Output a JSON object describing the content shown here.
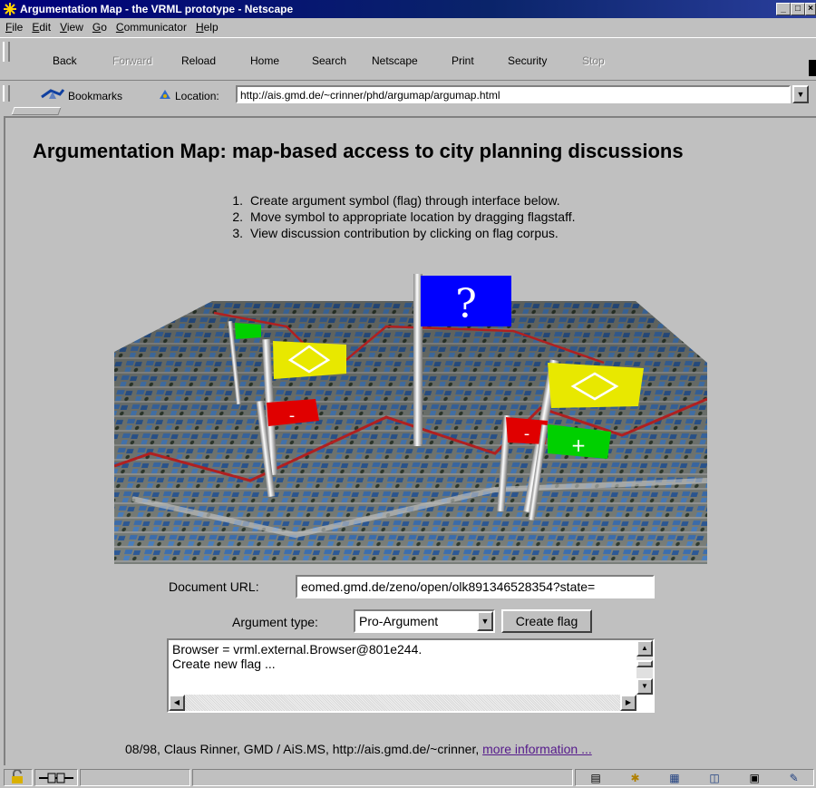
{
  "window": {
    "title": "Argumentation Map - the VRML prototype - Netscape",
    "controls": {
      "minimize": "_",
      "maximize": "□",
      "close": "×"
    }
  },
  "menu": [
    {
      "label": "File",
      "accel": "F"
    },
    {
      "label": "Edit",
      "accel": "E"
    },
    {
      "label": "View",
      "accel": "V"
    },
    {
      "label": "Go",
      "accel": "G"
    },
    {
      "label": "Communicator",
      "accel": "C"
    },
    {
      "label": "Help",
      "accel": "H"
    }
  ],
  "toolbar": {
    "back": "Back",
    "forward": "Forward",
    "reload": "Reload",
    "home": "Home",
    "search": "Search",
    "netscape": "Netscape",
    "print": "Print",
    "security": "Security",
    "stop": "Stop"
  },
  "location_bar": {
    "bookmarks_label": "Bookmarks",
    "location_label": "Location:",
    "url": "http://ais.gmd.de/~crinner/phd/argumap/argumap.html"
  },
  "page": {
    "title": "Argumentation Map: map-based access to city planning discussions",
    "steps": [
      "Create argument symbol (flag) through interface below.",
      "Move symbol to appropriate location by dragging flagstaff.",
      "View discussion contribution by clicking on flag corpus."
    ],
    "flags": [
      {
        "symbol": "?",
        "color": "#0000ff"
      },
      {
        "symbol": "◇",
        "color": "#e8e800"
      },
      {
        "symbol": "◇",
        "color": "#e8e800"
      },
      {
        "symbol": "-",
        "color": "#e00000"
      },
      {
        "symbol": "-",
        "color": "#e00000"
      },
      {
        "symbol": "+",
        "color": "#00d000"
      },
      {
        "symbol": "",
        "color": "#00d000"
      }
    ],
    "form": {
      "doc_url_label": "Document URL:",
      "doc_url_value": "eomed.gmd.de/zeno/open/olk891346528354?state=",
      "argtype_label": "Argument type:",
      "argtype_value": "Pro-Argument",
      "create_flag_label": "Create flag",
      "console_text": "Browser = vrml.external.Browser@801e244.\nCreate new flag ..."
    },
    "footer": {
      "text": "08/98, Claus Rinner, GMD / AiS.MS, http://ais.gmd.de/~crinner, ",
      "link": "more information ..."
    }
  },
  "colors": {
    "titlebar": "#00007b",
    "chrome": "#c0c0c0",
    "link": "#551a8b"
  }
}
